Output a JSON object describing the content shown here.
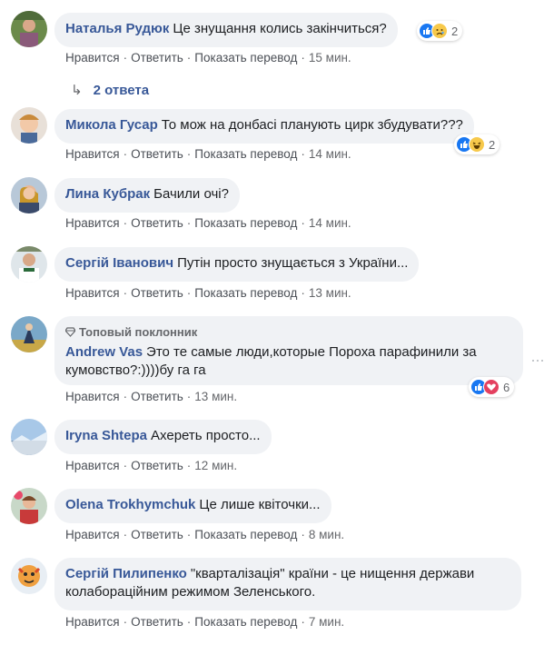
{
  "actions": {
    "like": "Нравится",
    "reply": "Ответить",
    "translate": "Показать перевод",
    "sep": "·"
  },
  "comments": [
    {
      "author": "Наталья Рудюк",
      "text": "Це знущання колись закінчиться?",
      "time": "15 мин.",
      "reactions": {
        "icons": [
          "like-icon",
          "sad-icon"
        ],
        "count": "2"
      }
    },
    {
      "author": "Микола Гусар",
      "text": "То мож на донбасі планують цирк збудувати???",
      "time": "14 мин.",
      "reactions": {
        "icons": [
          "like-icon",
          "haha-icon"
        ],
        "count": "2"
      }
    },
    {
      "author": "Лина Кубрак",
      "text": "Бачили очі?",
      "time": "14 мин."
    },
    {
      "author": "Сергій Іванович",
      "text": "Путін просто знущається з України...",
      "time": "13 мин."
    },
    {
      "badge": "Топовый поклонник",
      "author": "Andrew Vas",
      "text": "Это те самые люди,которые Пороха парафинили за кумовство?:))))бу га га",
      "time": "13 мин.",
      "reactions": {
        "icons": [
          "like-icon",
          "love-icon"
        ],
        "count": "6"
      }
    },
    {
      "author": "Iryna Shtepa",
      "text": "Ахереть просто...",
      "time": "12 мин."
    },
    {
      "author": "Olena Trokhymchuk",
      "text": "Це лише квіточки...",
      "time": "8 мин."
    },
    {
      "author": "Сергій Пилипенко",
      "text": "\"кварталізація\" країни - це нищення держави колабораційним режимом Зеленського.",
      "time": "7 мин."
    }
  ],
  "replies_label": "2 ответа",
  "colors": {
    "link": "#385898",
    "bubble": "#f0f2f5",
    "like": "#1877f2",
    "love": "#e4405f"
  }
}
